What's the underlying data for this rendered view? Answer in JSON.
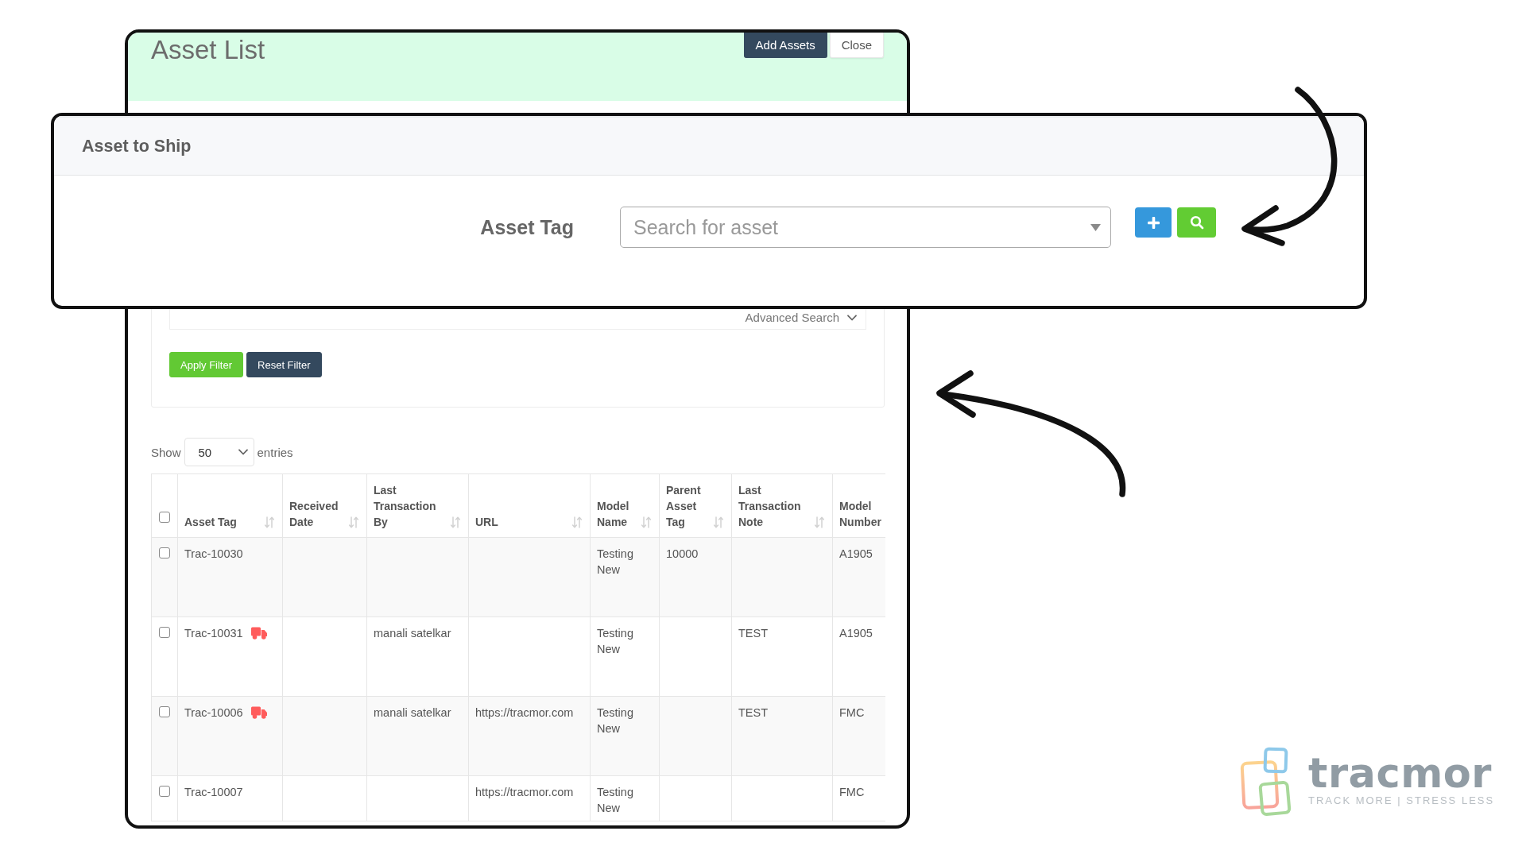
{
  "asset_list": {
    "title": "Asset List",
    "header_buttons": [
      {
        "label": "Add Assets",
        "kind": "dark"
      },
      {
        "label": "Close",
        "kind": "light"
      }
    ],
    "advanced_search": {
      "label": "Advanced Search",
      "expanded": false
    },
    "filter_buttons": [
      {
        "label": "Apply Filter",
        "kind": "success"
      },
      {
        "label": "Reset Filter",
        "kind": "dark"
      }
    ],
    "page_length": {
      "label": "Show",
      "value": "50",
      "suffix": "entries"
    },
    "table": {
      "select_all_checked": false,
      "columns": [
        {
          "label": "Asset Tag",
          "sortable": true
        },
        {
          "label": "Received Date",
          "sortable": true
        },
        {
          "label": "Last Transaction By",
          "sortable": true
        },
        {
          "label": "URL",
          "sortable": true
        },
        {
          "label": "Model Name",
          "sortable": true
        },
        {
          "label": "Parent Asset Tag",
          "sortable": true
        },
        {
          "label": "Last Transaction Note",
          "sortable": true
        },
        {
          "label": "Model Number",
          "sortable": false
        }
      ],
      "rows": [
        {
          "checked": false,
          "asset_tag": "Trac-10030",
          "truck_icon": false,
          "model_name": "Testing New",
          "parent_asset_tag": "10000",
          "model_number": "A1905"
        },
        {
          "checked": false,
          "asset_tag": "Trac-10031",
          "truck_icon": true,
          "last_transaction_by": "manali satelkar",
          "model_name": "Testing New",
          "last_transaction_note": "TEST",
          "model_number": "A1905"
        },
        {
          "checked": false,
          "asset_tag": "Trac-10006",
          "truck_icon": true,
          "last_transaction_by": "manali satelkar",
          "url": "https://tracmor.com",
          "model_name": "Testing New",
          "last_transaction_note": "TEST",
          "model_number": "FMC"
        },
        {
          "checked": false,
          "asset_tag": "Trac-10007",
          "truck_icon": false,
          "url": "https://tracmor.com",
          "model_name": "Testing New",
          "model_number": "FMC"
        }
      ]
    }
  },
  "asset_to_ship": {
    "title": "Asset to Ship",
    "field_label": "Asset Tag",
    "search": {
      "placeholder": "Search for asset"
    }
  },
  "logo": {
    "wordmark": "tracmor",
    "tagline": "TRACK MORE | STRESS LESS"
  }
}
